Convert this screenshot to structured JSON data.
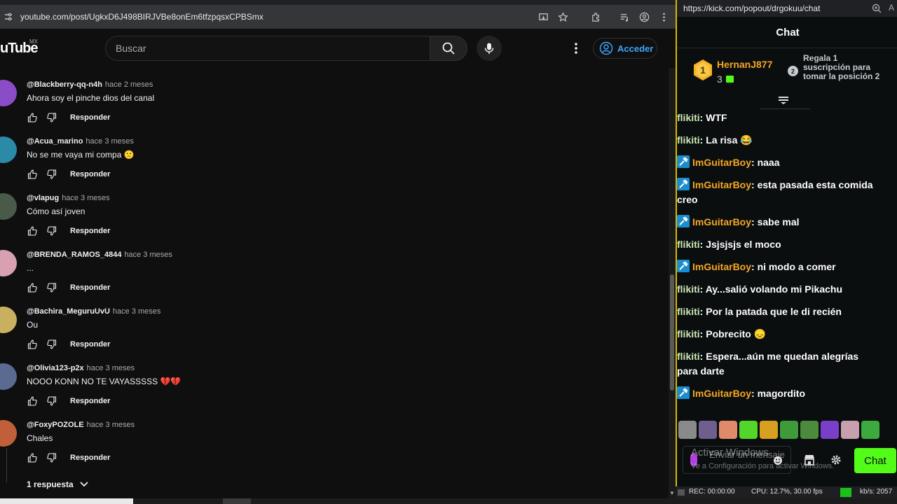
{
  "youtube": {
    "url": "youtube.com/post/UgkxD6J498BIRJVBe8onEm6tfzpqsxCPBSmx",
    "logo": "uTube",
    "logo_region": "MX",
    "search_placeholder": "Buscar",
    "signin_label": "Acceder",
    "reply_label": "Responder",
    "replies_toggle": "1 respuesta",
    "comments": [
      {
        "author": "@Blackberry-qq-n4h",
        "time": "hace 2 meses",
        "text": "Ahora soy el pinche dios del canal"
      },
      {
        "author": "@Acua_marino",
        "time": "hace 3 meses",
        "text": "No se me vaya mi compa 🙁"
      },
      {
        "author": "@vlapug",
        "time": "hace 3 meses",
        "text": "Cómo así joven"
      },
      {
        "author": "@BRENDA_RAMOS_4844",
        "time": "hace 3 meses",
        "text": "..."
      },
      {
        "author": "@Bachira_MeguruUvU",
        "time": "hace 3 meses",
        "text": "Ou"
      },
      {
        "author": "@Olivia123-p2x",
        "time": "hace 3 meses",
        "text": "NOOO KONN NO TE VAYASSSSS 💔💔"
      },
      {
        "author": "@FoxyPOZOLE",
        "time": "hace 3 meses",
        "text": "Chales"
      }
    ]
  },
  "kick": {
    "url": "https://kick.com/popout/drgokuu/chat",
    "url_extra": "A",
    "header_title": "Chat",
    "pinned": {
      "rank": "1",
      "user": "HernanJ877",
      "count": "3",
      "next_rank": "2",
      "cta": "Regala 1 suscripción para tomar la posición 2"
    },
    "messages": [
      {
        "user": "flikiti",
        "badge": false,
        "color": "green",
        "text": "WTF"
      },
      {
        "user": "flikiti",
        "badge": false,
        "color": "green",
        "text": "La risa 😂"
      },
      {
        "user": "ImGuitarBoy",
        "badge": true,
        "color": "orange",
        "text": "naaa"
      },
      {
        "user": "ImGuitarBoy",
        "badge": true,
        "color": "orange",
        "text": "esta pasada esta comida creo"
      },
      {
        "user": "ImGuitarBoy",
        "badge": true,
        "color": "orange",
        "text": "sabe mal"
      },
      {
        "user": "flikiti",
        "badge": false,
        "color": "green",
        "text": "Jsjsjsjs el moco"
      },
      {
        "user": "ImGuitarBoy",
        "badge": true,
        "color": "orange",
        "text": "ni modo a comer"
      },
      {
        "user": "flikiti",
        "badge": false,
        "color": "green",
        "text": "Ay...salió volando mi Pikachu"
      },
      {
        "user": "flikiti",
        "badge": false,
        "color": "green",
        "text": "Por la patada que le di recién"
      },
      {
        "user": "flikiti",
        "badge": false,
        "color": "green",
        "text": "Pobrecito 😞"
      },
      {
        "user": "flikiti",
        "badge": false,
        "color": "green",
        "text": "Espera...aún me quedan alegrías para darte"
      },
      {
        "user": "ImGuitarBoy",
        "badge": true,
        "color": "orange",
        "text": "magordito"
      }
    ],
    "input_placeholder": "Enviar un mensaje",
    "chat_button": "Chat",
    "windows_watermark": "Activar Windows",
    "windows_watermark_sub": "Ve a Configuración para activar Windows.",
    "emote_colors": [
      "#8a8a8a",
      "#6f5e8e",
      "#e08a6a",
      "#53d62a",
      "#d8a020",
      "#3f9a3a",
      "#4c8a3c",
      "#7a3fc8",
      "#c7a0b0",
      "#3caa3c"
    ]
  },
  "status_bar": {
    "rec": "REC: 00:00:00",
    "cpu": "CPU: 12.7%, 30.00 fps",
    "kbs": "kb/s: 2057"
  },
  "colors": {
    "yt_bg": "#0f0f0f",
    "yt_link": "#3ea6ff",
    "kick_green": "#53fc18",
    "kick_orange": "#f5a623",
    "kick_border": "#d6b800"
  }
}
